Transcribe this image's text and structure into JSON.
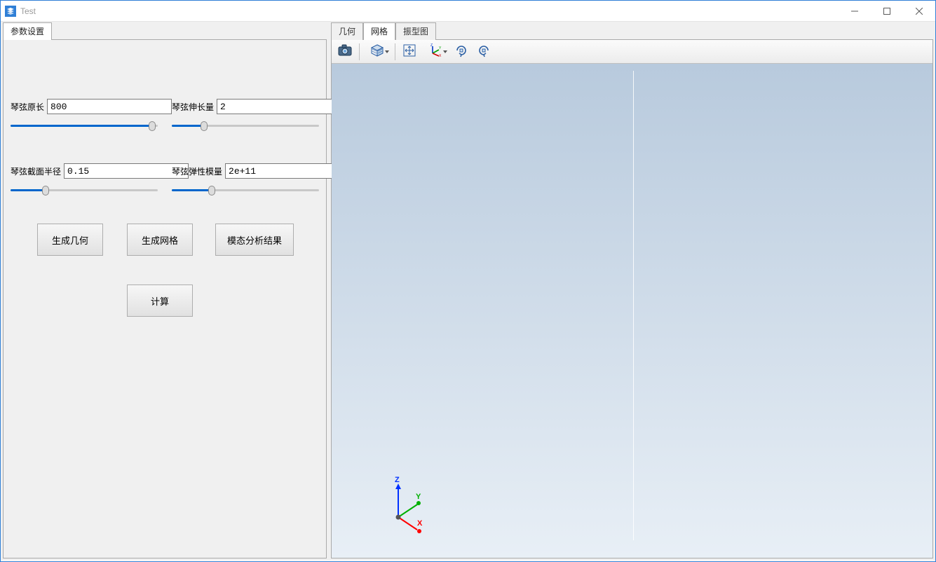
{
  "window": {
    "title": "Test"
  },
  "left": {
    "tab_label": "参数设置",
    "params": {
      "length": {
        "label": "琴弦原长",
        "value": "800",
        "slider_pct": 96
      },
      "elongation": {
        "label": "琴弦伸长量",
        "value": "2",
        "slider_pct": 22
      },
      "radius": {
        "label": "琴弦截面半径",
        "value": "0.15",
        "slider_pct": 24
      },
      "modulus": {
        "label": "琴弦弹性模量",
        "value": "2e+11",
        "slider_pct": 27
      }
    },
    "buttons": {
      "gen_geometry": "生成几何",
      "gen_mesh": "生成网格",
      "modal_result": "模态分析结果",
      "compute": "计算"
    }
  },
  "right": {
    "tabs": {
      "geometry": "几何",
      "mesh": "网格",
      "mode_shape": "振型图"
    }
  },
  "triad": {
    "x": "X",
    "y": "Y",
    "z": "Z"
  }
}
